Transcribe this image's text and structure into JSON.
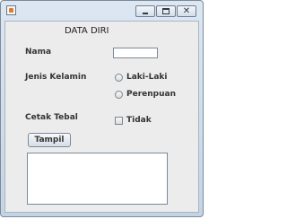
{
  "window": {
    "app_icon": "java-coffee-icon",
    "controls": {
      "minimize_icon": "minimize-icon",
      "maximize_icon": "maximize-icon",
      "close_icon": "close-icon",
      "close_glyph": "✕"
    }
  },
  "form": {
    "title": "DATA DIRI",
    "nama_label": "Nama",
    "nama_value": "",
    "jenis_kelamin_label": "Jenis Kelamin",
    "gender_options": [
      {
        "label": "Laki-Laki",
        "selected": false
      },
      {
        "label": "Perenpuan",
        "selected": false
      }
    ],
    "cetak_tebal_label": "Cetak Tebal",
    "bold_option": {
      "label": "Tidak",
      "checked": false
    },
    "tampil_button": "Tampil",
    "output_text": ""
  }
}
